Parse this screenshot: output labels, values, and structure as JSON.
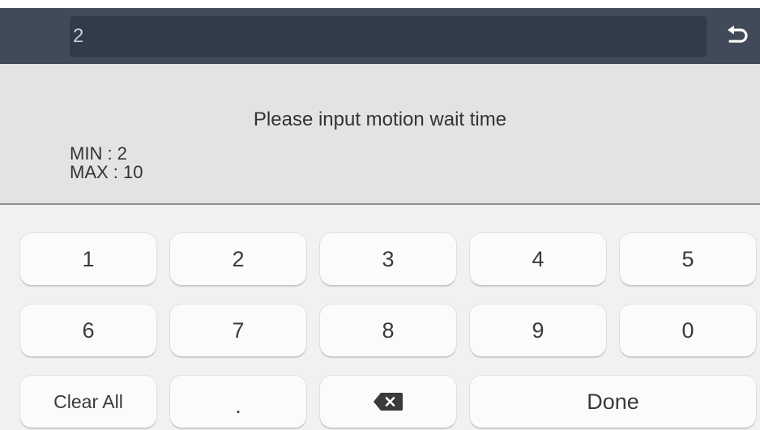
{
  "input": {
    "value": "2"
  },
  "prompt": {
    "text": "Please input motion wait time",
    "min_label": "MIN : 2",
    "max_label": "MAX : 10"
  },
  "keypad": {
    "row1": [
      "1",
      "2",
      "3",
      "4",
      "5"
    ],
    "row2": [
      "6",
      "7",
      "8",
      "9",
      "0"
    ],
    "clear_all": "Clear All",
    "dot": ".",
    "done": "Done"
  },
  "icons": {
    "back": "undo-arrow-icon",
    "backspace": "backspace-icon"
  },
  "colors": {
    "topbar": "#404a59",
    "input_bg": "#323b49",
    "prompt_bg": "#e3e3e3",
    "key_bg": "#fbfbfb"
  }
}
